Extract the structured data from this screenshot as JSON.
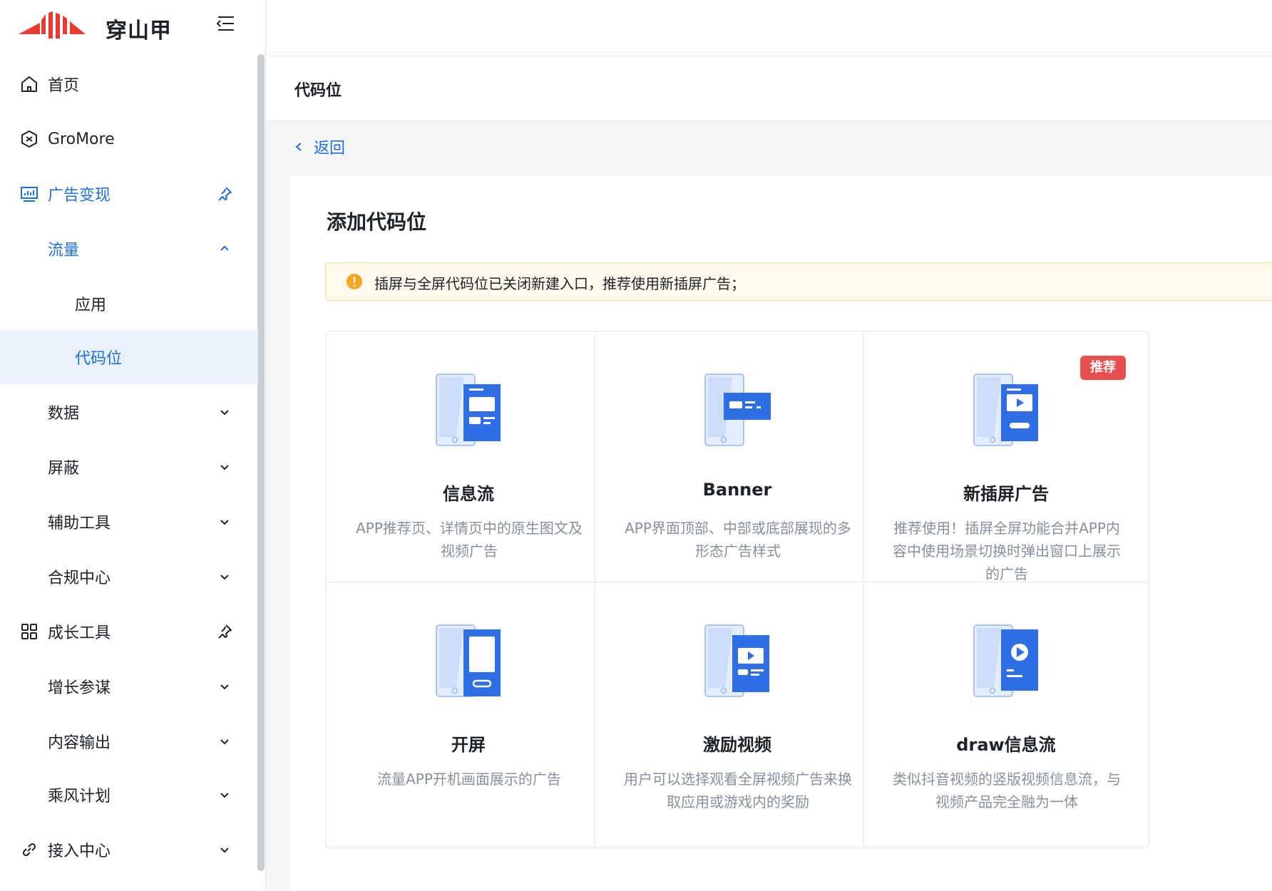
{
  "brand": {
    "name": "穿山甲"
  },
  "sidebar": {
    "items": [
      {
        "label": "首页",
        "icon": "home-icon"
      },
      {
        "label": "GroMore",
        "icon": "gromore-icon"
      },
      {
        "label": "广告变现",
        "icon": "monitor-chart-icon",
        "active": true
      },
      {
        "label": "流量",
        "active": true,
        "expanded": true
      },
      {
        "label": "应用"
      },
      {
        "label": "代码位",
        "selected": true
      },
      {
        "label": "数据"
      },
      {
        "label": "屏蔽"
      },
      {
        "label": "辅助工具"
      },
      {
        "label": "合规中心"
      },
      {
        "label": "成长工具",
        "icon": "grid-icon"
      },
      {
        "label": "增长参谋"
      },
      {
        "label": "内容输出"
      },
      {
        "label": "乘风计划"
      },
      {
        "label": "接入中心",
        "icon": "link-icon"
      }
    ]
  },
  "page": {
    "title": "代码位",
    "back_label": "返回",
    "panel_title": "添加代码位",
    "notice": "插屏与全屏代码位已关闭新建入口，推荐使用新插屏广告；"
  },
  "cards": [
    {
      "title": "信息流",
      "desc": "APP推荐页、详情页中的原生图文及视频广告",
      "icon": "feed-ad-icon"
    },
    {
      "title": "Banner",
      "desc": "APP界面顶部、中部或底部展现的多形态广告样式",
      "icon": "banner-ad-icon"
    },
    {
      "title": "新插屏广告",
      "desc": "推荐使用！插屏全屏功能合并APP内容中使用场景切换时弹出窗口上展示的广告",
      "icon": "interstitial-ad-icon",
      "badge": "推荐"
    },
    {
      "title": "开屏",
      "desc": "流量APP开机画面展示的广告",
      "icon": "splash-ad-icon"
    },
    {
      "title": "激励视频",
      "desc": "用户可以选择观看全屏视频广告来换取应用或游戏内的奖励",
      "icon": "reward-video-icon"
    },
    {
      "title": "draw信息流",
      "desc": "类似抖音视频的竖版视频信息流，与视频产品完全融为一体",
      "icon": "draw-feed-icon"
    }
  ],
  "colors": {
    "primary": "#1e6fdb",
    "brand_red": "#e83a2e",
    "warning": "#f5a623",
    "badge": "#e8504f"
  }
}
